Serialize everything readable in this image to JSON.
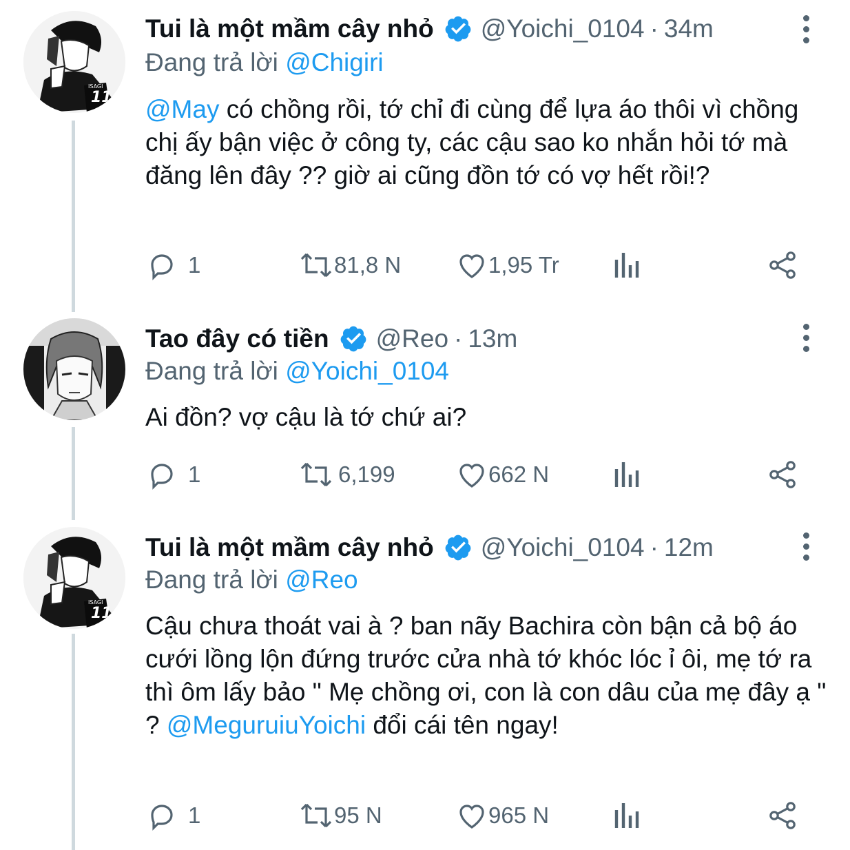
{
  "colors": {
    "accent": "#1d9bf0",
    "text": "#0f1419",
    "muted": "#536471",
    "thread_line": "#cfd9de"
  },
  "tweets": [
    {
      "display_name": "Tui là một mầm cây nhỏ",
      "handle": "@Yoichi_0104",
      "dot": "·",
      "time": "34m",
      "reply_prefix": "Đang trả lời",
      "reply_to": "@Chigiri",
      "mention": "@May",
      "text": " có chồng rồi, tớ chỉ đi cùng để lựa áo thôi vì chồng chị ấy bận việc ở công ty, các cậu sao ko nhắn hỏi tớ mà đăng lên đây ?? giờ ai cũng đồn tớ có vợ hết rồi!?",
      "replies": "1",
      "retweets": "81,8 N",
      "likes": "1,95 Tr",
      "avatar_icon": "manga-avatar-isagi"
    },
    {
      "display_name": "Tao đây có tiền",
      "handle": "@Reo",
      "dot": "·",
      "time": "13m",
      "reply_prefix": "Đang trả lời",
      "reply_to": "@Yoichi_0104",
      "text": "Ai đồn? vợ cậu là tớ chứ ai?",
      "replies": "1",
      "retweets": "6,199",
      "likes": "662 N",
      "avatar_icon": "manga-avatar-reo"
    },
    {
      "display_name": "Tui là một mầm cây nhỏ",
      "handle": "@Yoichi_0104",
      "dot": "·",
      "time": "12m",
      "reply_prefix": "Đang trả lời",
      "reply_to": "@Reo",
      "text_before": "Cậu chưa thoát vai à ? ban nãy Bachira còn bận cả bộ áo cưới lồng lộn đứng trước cửa nhà tớ khóc lóc ỉ ôi, mẹ tớ ra thì ôm lấy bảo \" Mẹ chồng ơi, con là con dâu của mẹ đây ạ \" ? ",
      "mention": "@MeguruiuYoichi",
      "text_after": " đổi cái tên ngay!",
      "replies": "1",
      "retweets": "95 N",
      "likes": "965 N",
      "avatar_icon": "manga-avatar-isagi"
    }
  ]
}
